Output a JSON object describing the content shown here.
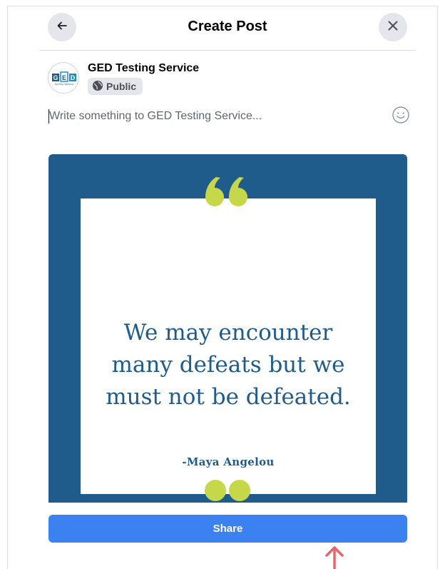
{
  "header": {
    "title": "Create Post",
    "back_icon": "arrow-left-icon",
    "close_icon": "close-icon"
  },
  "author": {
    "name": "GED Testing Service",
    "privacy_label": "Public",
    "privacy_icon": "globe-icon",
    "avatar_text": "GED",
    "avatar_subtext": "TESTING SERVICE"
  },
  "composer": {
    "placeholder": "Write something to GED Testing Service...",
    "value": "",
    "emoji_icon": "smiley-icon"
  },
  "media": {
    "quote_line1": "We may encounter",
    "quote_line2": "many defeats but we",
    "quote_line3": "must not be defeated.",
    "quote_author": "-Maya Angelou",
    "colors": {
      "frame": "#1f5c8b",
      "accent": "#c7d74a",
      "card": "#ffffff"
    }
  },
  "share_button": {
    "label": "Share"
  },
  "colors": {
    "primary": "#3b82f0",
    "pointer": "#e8636a"
  }
}
